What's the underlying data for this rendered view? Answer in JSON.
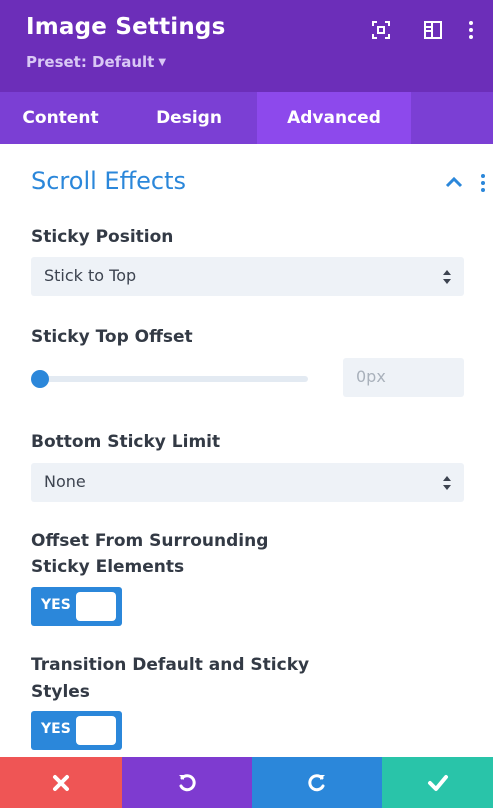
{
  "header": {
    "title": "Image Settings",
    "preset_label": "Preset: Default",
    "icons": [
      "focus-mode-icon",
      "split-view-icon",
      "more-vertical-icon"
    ]
  },
  "tabs": [
    {
      "label": "Content",
      "active": false
    },
    {
      "label": "Design",
      "active": false
    },
    {
      "label": "Advanced",
      "active": true
    }
  ],
  "section": {
    "title": "Scroll Effects",
    "expanded": true
  },
  "fields": {
    "sticky_position": {
      "label": "Sticky Position",
      "value": "Stick to Top"
    },
    "sticky_top_offset": {
      "label": "Sticky Top Offset",
      "slider_fraction": 0,
      "placeholder": "0px"
    },
    "bottom_sticky_limit": {
      "label": "Bottom Sticky Limit",
      "value": "None"
    },
    "offset_from_surrounding": {
      "label_line1": "Offset From Surrounding",
      "label_line2": "Sticky Elements",
      "toggle_label": "YES",
      "on": true
    },
    "transition_default": {
      "label_line1": "Transition Default and Sticky",
      "label_line2": "Styles",
      "toggle_label": "YES",
      "on": true
    }
  },
  "footer": {
    "buttons": [
      "cancel",
      "undo",
      "redo",
      "save"
    ]
  },
  "colors": {
    "header_bg": "#6c2eb9",
    "tab_active_bg": "#8d49ec",
    "accent_blue": "#2b87da",
    "cancel": "#ef5555",
    "undo": "#7e3bd0",
    "redo": "#2b87da",
    "save": "#29c4a9"
  }
}
